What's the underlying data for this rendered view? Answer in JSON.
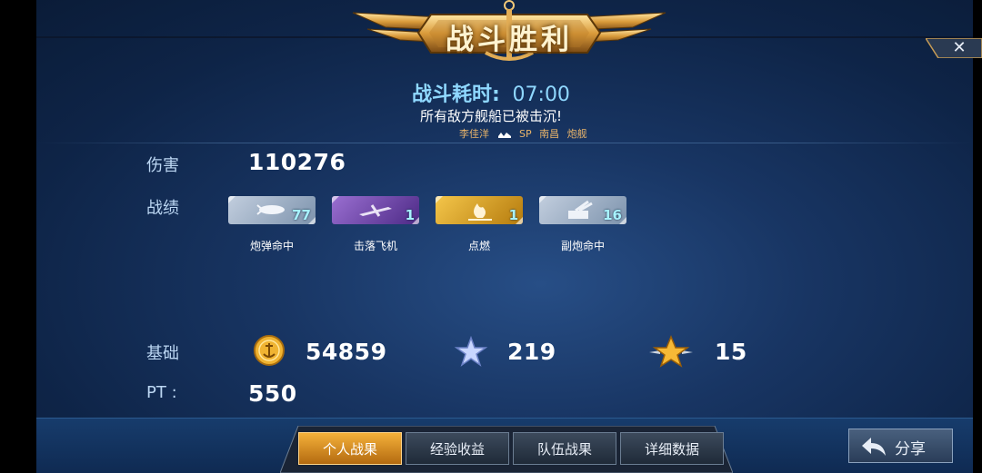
{
  "banner": {
    "title": "战斗胜利"
  },
  "header": {
    "time_label": "战斗耗时:",
    "time_value": "07:00",
    "result_text": "所有敌方舰船已被击沉!",
    "player_name": "李佳洋",
    "ship_rarity": "SP",
    "ship_name": "南昌",
    "ship_type": "炮舰"
  },
  "damage": {
    "label": "伤害",
    "value": "110276"
  },
  "record": {
    "label": "战绩",
    "items": [
      {
        "icon": "torpedo-shell-icon",
        "count": "77",
        "caption": "炮弹命中",
        "color": "#8fa3ba"
      },
      {
        "icon": "aircraft-icon",
        "count": "1",
        "caption": "击落飞机",
        "color": "#7a4fb3"
      },
      {
        "icon": "fire-icon",
        "count": "1",
        "caption": "点燃",
        "color": "#d9a21f"
      },
      {
        "icon": "secondary-gun-icon",
        "count": "16",
        "caption": "副炮命中",
        "color": "#8fa3ba"
      }
    ]
  },
  "base": {
    "label": "基础",
    "gold": "54859",
    "exp_star": "219",
    "rank_star": "15"
  },
  "pt": {
    "label": "PT :",
    "value": "550"
  },
  "tabs": [
    "个人战果",
    "经验收益",
    "队伍战果",
    "详细数据"
  ],
  "share": {
    "label": "分享"
  },
  "colors": {
    "accent_gold": "#f5b13a",
    "title_blue": "#8fd8ff",
    "label_blue": "#bcd7f3"
  }
}
